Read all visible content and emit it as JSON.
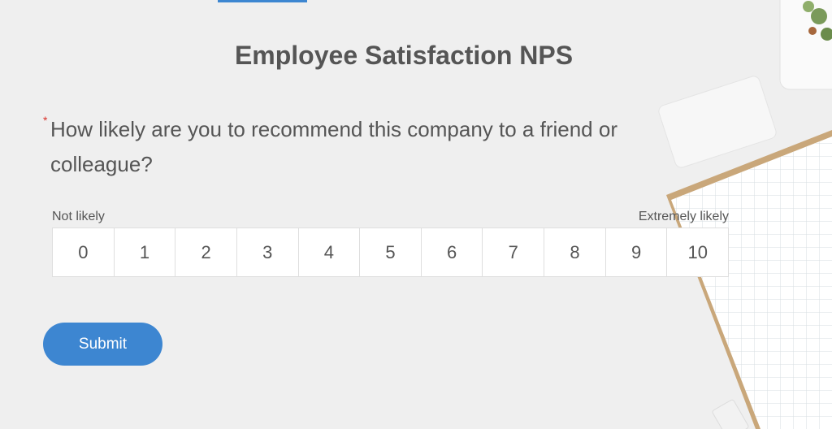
{
  "form": {
    "title": "Employee Satisfaction NPS",
    "required_mark": "*",
    "question": "How likely are you to recommend this company to a friend or colleague?",
    "scale_low_label": "Not likely",
    "scale_high_label": "Extremely likely",
    "scale_options": [
      "0",
      "1",
      "2",
      "3",
      "4",
      "5",
      "6",
      "7",
      "8",
      "9",
      "10"
    ],
    "submit_label": "Submit"
  },
  "colors": {
    "accent": "#3d86d1",
    "required": "#d9322b",
    "background": "#efefef"
  }
}
